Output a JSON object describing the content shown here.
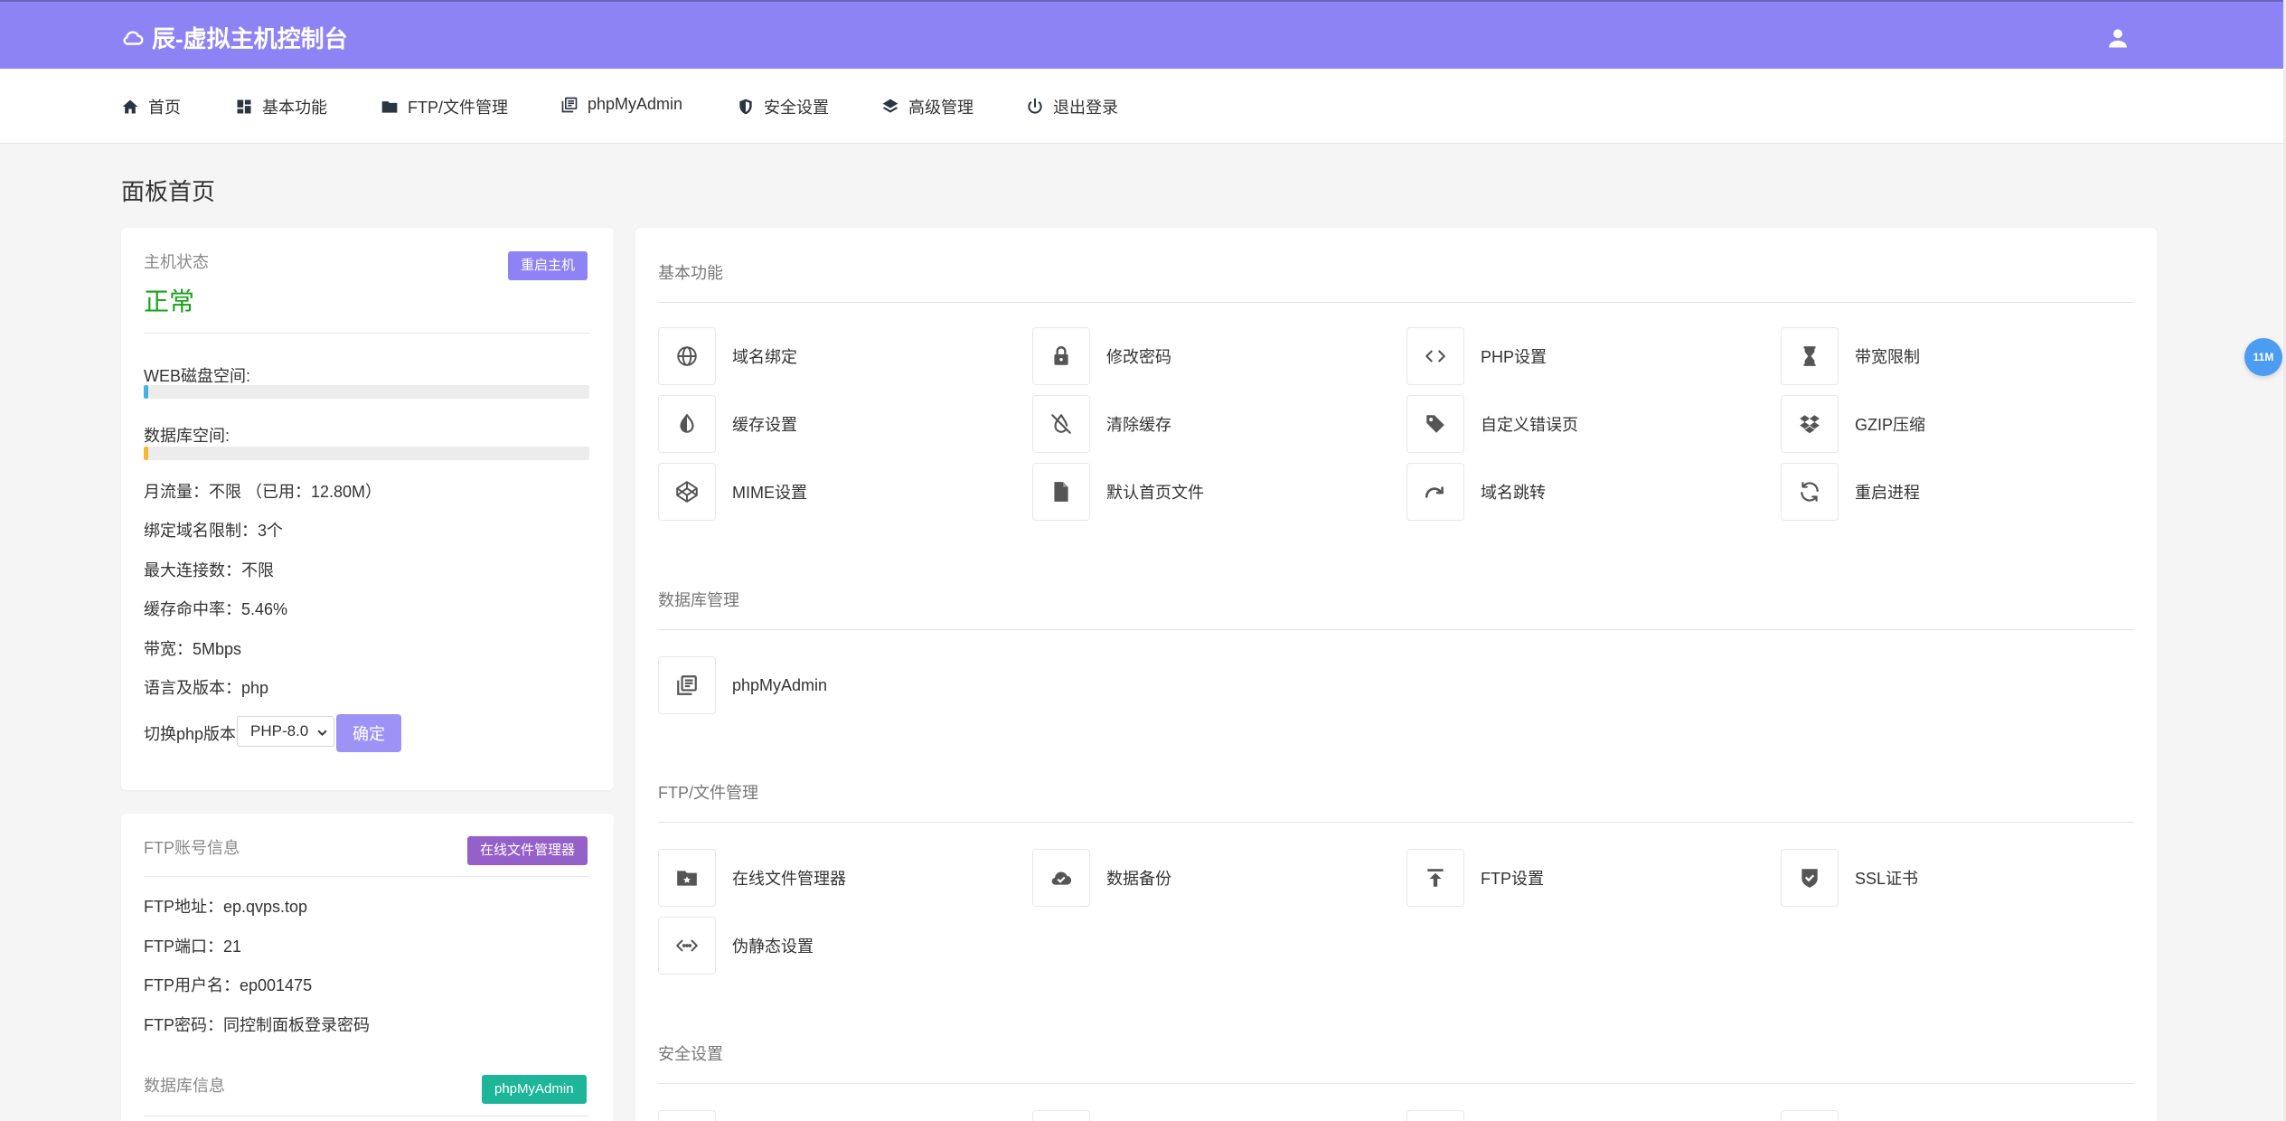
{
  "app": {
    "title": "辰-虚拟主机控制台"
  },
  "nav": [
    {
      "label": "首页",
      "icon": "home-icon"
    },
    {
      "label": "基本功能",
      "icon": "grid-icon"
    },
    {
      "label": "FTP/文件管理",
      "icon": "folder-icon"
    },
    {
      "label": "phpMyAdmin",
      "icon": "library-icon"
    },
    {
      "label": "安全设置",
      "icon": "shield-icon"
    },
    {
      "label": "高级管理",
      "icon": "layers-icon"
    },
    {
      "label": "退出登录",
      "icon": "power-icon"
    }
  ],
  "page_title": "面板首页",
  "host_status": {
    "label": "主机状态",
    "value": "正常",
    "restart_button": "重启主机",
    "web_disk_label": "WEB磁盘空间:",
    "web_disk_usage": 0.01,
    "db_space_label": "数据库空间:",
    "db_space_usage": 0.01,
    "monthly_traffic": "月流量：不限 （已用：12.80M）",
    "domain_limit": "绑定域名限制：3个",
    "max_connections": "最大连接数：不限",
    "cache_hit_rate": "缓存命中率：5.46%",
    "bandwidth": "带宽：5Mbps",
    "language_version": "语言及版本：php",
    "switch_php_label": "切换php版本:",
    "php_selected": "PHP-8.0",
    "confirm_button": "确定"
  },
  "ftp_info": {
    "title": "FTP账号信息",
    "file_manager_button": "在线文件管理器",
    "address": "FTP地址：ep.qvps.top",
    "port": "FTP端口：21",
    "username": "FTP用户名：ep001475",
    "password": "FTP密码：同控制面板登录密码"
  },
  "db_info": {
    "title": "数据库信息",
    "phpmyadmin_button": "phpMyAdmin"
  },
  "sections": {
    "basic": {
      "title": "基本功能",
      "items": [
        {
          "label": "域名绑定",
          "icon": "globe-icon"
        },
        {
          "label": "修改密码",
          "icon": "lock-icon"
        },
        {
          "label": "PHP设置",
          "icon": "code-icon"
        },
        {
          "label": "带宽限制",
          "icon": "hourglass-icon"
        },
        {
          "label": "缓存设置",
          "icon": "contrast-icon"
        },
        {
          "label": "清除缓存",
          "icon": "tint-slash-icon"
        },
        {
          "label": "自定义错误页",
          "icon": "tag-icon"
        },
        {
          "label": "GZIP压缩",
          "icon": "dropbox-icon"
        },
        {
          "label": "MIME设置",
          "icon": "codepen-icon"
        },
        {
          "label": "默认首页文件",
          "icon": "file-icon"
        },
        {
          "label": "域名跳转",
          "icon": "redo-icon"
        },
        {
          "label": "重启进程",
          "icon": "sync-icon"
        }
      ]
    },
    "database": {
      "title": "数据库管理",
      "items": [
        {
          "label": "phpMyAdmin",
          "icon": "library-icon"
        }
      ]
    },
    "ftp": {
      "title": "FTP/文件管理",
      "items": [
        {
          "label": "在线文件管理器",
          "icon": "folder-star-icon"
        },
        {
          "label": "数据备份",
          "icon": "cloud-check-icon"
        },
        {
          "label": "FTP设置",
          "icon": "upload-icon"
        },
        {
          "label": "SSL证书",
          "icon": "shield-check-icon"
        },
        {
          "label": "伪静态设置",
          "icon": "code-dots-icon"
        }
      ]
    },
    "security": {
      "title": "安全设置"
    }
  },
  "float_badge": "11M",
  "colors": {
    "header": "#8e83f5",
    "status_ok": "#19a119",
    "web_disk_bar": "#3fb4e0",
    "db_space_bar": "#f5b72c",
    "file_manager_button": "#9560c9",
    "phpmyadmin_button": "#1db698",
    "float_badge": "#4a9df0"
  }
}
